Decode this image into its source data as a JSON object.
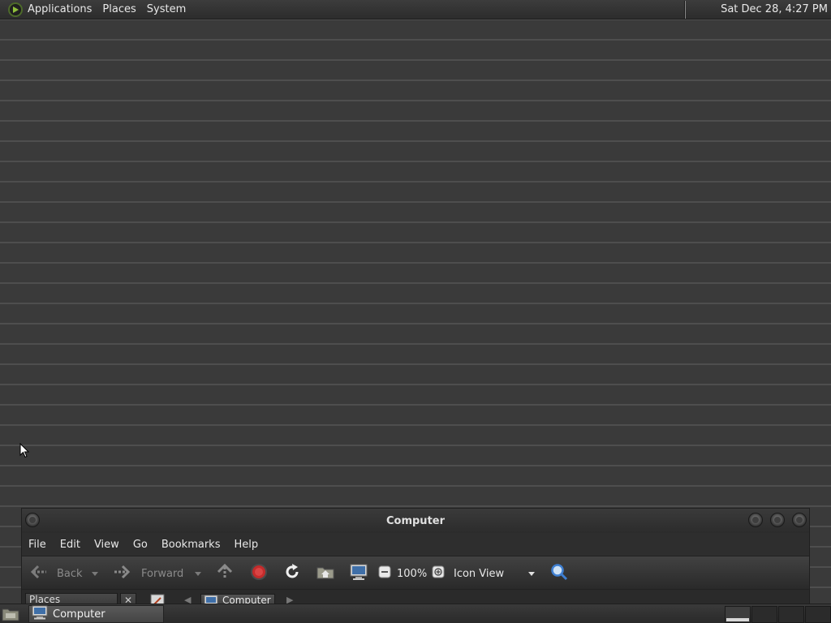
{
  "top_panel": {
    "menus": [
      "Applications",
      "Places",
      "System"
    ],
    "clock": "Sat Dec 28,  4:27 PM"
  },
  "window": {
    "title": "Computer",
    "menu": [
      "File",
      "Edit",
      "View",
      "Go",
      "Bookmarks",
      "Help"
    ],
    "toolbar": {
      "back_label": "Back",
      "forward_label": "Forward",
      "zoom_value": "100%",
      "view_mode": "Icon View"
    },
    "location": {
      "sidebar_mode": "Places",
      "breadcrumb": "Computer"
    }
  },
  "bottom_panel": {
    "task_label": "Computer"
  },
  "colors": {
    "desktop_bg": "#3a3a3a",
    "stop_red": "#c42b2b",
    "search_blue": "#3f7fd1"
  }
}
